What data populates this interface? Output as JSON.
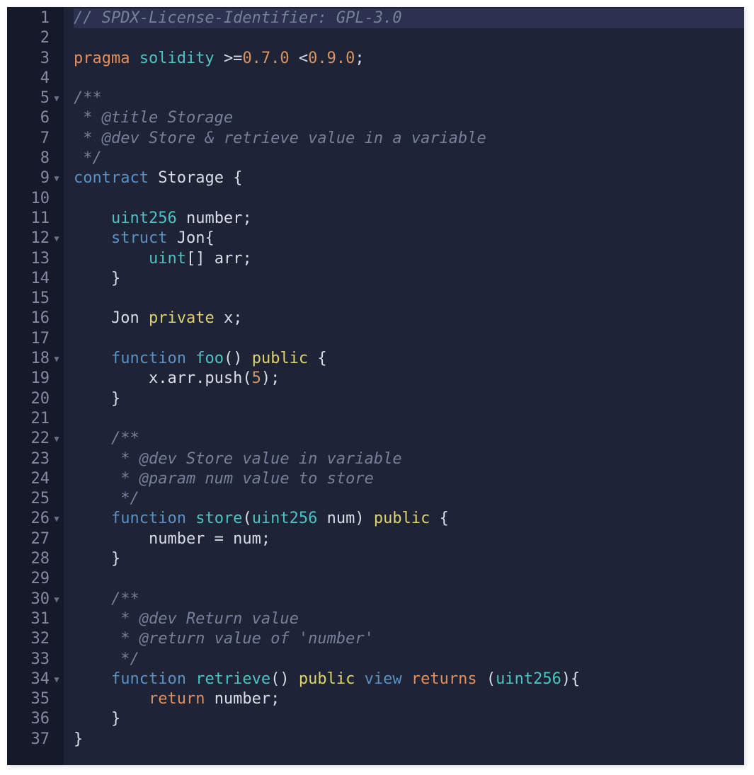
{
  "lines": [
    {
      "n": 1,
      "fold": false,
      "active": true,
      "tokens": [
        {
          "t": "// SPDX-License-Identifier: GPL-3.0",
          "c": "c"
        }
      ]
    },
    {
      "n": 2,
      "fold": false,
      "tokens": [
        {
          "t": "",
          "c": "op"
        }
      ]
    },
    {
      "n": 3,
      "fold": false,
      "tokens": [
        {
          "t": "pragma ",
          "c": "kw"
        },
        {
          "t": "solidity ",
          "c": "cy"
        },
        {
          "t": ">=",
          "c": "op"
        },
        {
          "t": "0.7.0",
          "c": "nm"
        },
        {
          "t": " <",
          "c": "op"
        },
        {
          "t": "0.9.0",
          "c": "nm"
        },
        {
          "t": ";",
          "c": "op"
        }
      ]
    },
    {
      "n": 4,
      "fold": false,
      "tokens": [
        {
          "t": "",
          "c": "op"
        }
      ]
    },
    {
      "n": 5,
      "fold": true,
      "tokens": [
        {
          "t": "/**",
          "c": "c"
        }
      ]
    },
    {
      "n": 6,
      "fold": false,
      "tokens": [
        {
          "t": " * @title Storage",
          "c": "c"
        }
      ]
    },
    {
      "n": 7,
      "fold": false,
      "tokens": [
        {
          "t": " * @dev Store & retrieve value in a variable",
          "c": "c"
        }
      ]
    },
    {
      "n": 8,
      "fold": false,
      "tokens": [
        {
          "t": " */",
          "c": "c"
        }
      ]
    },
    {
      "n": 9,
      "fold": true,
      "tokens": [
        {
          "t": "contract ",
          "c": "kw2"
        },
        {
          "t": "Storage ",
          "c": "op"
        },
        {
          "t": "{",
          "c": "op"
        }
      ]
    },
    {
      "n": 10,
      "fold": false,
      "tokens": [
        {
          "t": "",
          "c": "op"
        }
      ]
    },
    {
      "n": 11,
      "fold": false,
      "tokens": [
        {
          "t": "    ",
          "c": "op"
        },
        {
          "t": "uint256 ",
          "c": "cy"
        },
        {
          "t": "number",
          "c": "op"
        },
        {
          "t": ";",
          "c": "op"
        }
      ]
    },
    {
      "n": 12,
      "fold": true,
      "tokens": [
        {
          "t": "    ",
          "c": "op"
        },
        {
          "t": "struct ",
          "c": "kw2"
        },
        {
          "t": "Jon",
          "c": "op"
        },
        {
          "t": "{",
          "c": "op"
        }
      ]
    },
    {
      "n": 13,
      "fold": false,
      "tokens": [
        {
          "t": "        ",
          "c": "op"
        },
        {
          "t": "uint",
          "c": "cy"
        },
        {
          "t": "[] ",
          "c": "op"
        },
        {
          "t": "arr",
          "c": "op"
        },
        {
          "t": ";",
          "c": "op"
        }
      ]
    },
    {
      "n": 14,
      "fold": false,
      "tokens": [
        {
          "t": "    }",
          "c": "op"
        }
      ]
    },
    {
      "n": 15,
      "fold": false,
      "tokens": [
        {
          "t": "",
          "c": "op"
        }
      ]
    },
    {
      "n": 16,
      "fold": false,
      "tokens": [
        {
          "t": "    Jon ",
          "c": "op"
        },
        {
          "t": "private ",
          "c": "yl"
        },
        {
          "t": "x",
          "c": "op"
        },
        {
          "t": ";",
          "c": "op"
        }
      ]
    },
    {
      "n": 17,
      "fold": false,
      "tokens": [
        {
          "t": "",
          "c": "op"
        }
      ]
    },
    {
      "n": 18,
      "fold": true,
      "tokens": [
        {
          "t": "    ",
          "c": "op"
        },
        {
          "t": "function ",
          "c": "kw2"
        },
        {
          "t": "foo",
          "c": "cy"
        },
        {
          "t": "() ",
          "c": "op"
        },
        {
          "t": "public ",
          "c": "yl"
        },
        {
          "t": "{",
          "c": "op"
        }
      ]
    },
    {
      "n": 19,
      "fold": false,
      "tokens": [
        {
          "t": "        x.arr.push(",
          "c": "op"
        },
        {
          "t": "5",
          "c": "nm"
        },
        {
          "t": ");",
          "c": "op"
        }
      ]
    },
    {
      "n": 20,
      "fold": false,
      "tokens": [
        {
          "t": "    }",
          "c": "op"
        }
      ]
    },
    {
      "n": 21,
      "fold": false,
      "tokens": [
        {
          "t": "",
          "c": "op"
        }
      ]
    },
    {
      "n": 22,
      "fold": true,
      "tokens": [
        {
          "t": "    /**",
          "c": "c"
        }
      ]
    },
    {
      "n": 23,
      "fold": false,
      "tokens": [
        {
          "t": "     * @dev Store value in variable",
          "c": "c"
        }
      ]
    },
    {
      "n": 24,
      "fold": false,
      "tokens": [
        {
          "t": "     * @param num value to store",
          "c": "c"
        }
      ]
    },
    {
      "n": 25,
      "fold": false,
      "tokens": [
        {
          "t": "     */",
          "c": "c"
        }
      ]
    },
    {
      "n": 26,
      "fold": true,
      "tokens": [
        {
          "t": "    ",
          "c": "op"
        },
        {
          "t": "function ",
          "c": "kw2"
        },
        {
          "t": "store",
          "c": "cy"
        },
        {
          "t": "(",
          "c": "op"
        },
        {
          "t": "uint256 ",
          "c": "cy"
        },
        {
          "t": "num",
          "c": "op"
        },
        {
          "t": ") ",
          "c": "op"
        },
        {
          "t": "public ",
          "c": "yl"
        },
        {
          "t": "{",
          "c": "op"
        }
      ]
    },
    {
      "n": 27,
      "fold": false,
      "tokens": [
        {
          "t": "        number = num;",
          "c": "op"
        }
      ]
    },
    {
      "n": 28,
      "fold": false,
      "tokens": [
        {
          "t": "    }",
          "c": "op"
        }
      ]
    },
    {
      "n": 29,
      "fold": false,
      "tokens": [
        {
          "t": "",
          "c": "op"
        }
      ]
    },
    {
      "n": 30,
      "fold": true,
      "tokens": [
        {
          "t": "    /**",
          "c": "c"
        }
      ]
    },
    {
      "n": 31,
      "fold": false,
      "tokens": [
        {
          "t": "     * @dev Return value ",
          "c": "c"
        }
      ]
    },
    {
      "n": 32,
      "fold": false,
      "tokens": [
        {
          "t": "     * @return value of 'number'",
          "c": "c"
        }
      ]
    },
    {
      "n": 33,
      "fold": false,
      "tokens": [
        {
          "t": "     */",
          "c": "c"
        }
      ]
    },
    {
      "n": 34,
      "fold": true,
      "tokens": [
        {
          "t": "    ",
          "c": "op"
        },
        {
          "t": "function ",
          "c": "kw2"
        },
        {
          "t": "retrieve",
          "c": "cy"
        },
        {
          "t": "() ",
          "c": "op"
        },
        {
          "t": "public ",
          "c": "yl"
        },
        {
          "t": "view ",
          "c": "kw2"
        },
        {
          "t": "returns ",
          "c": "kw"
        },
        {
          "t": "(",
          "c": "op"
        },
        {
          "t": "uint256",
          "c": "cy"
        },
        {
          "t": "){",
          "c": "op"
        }
      ]
    },
    {
      "n": 35,
      "fold": false,
      "tokens": [
        {
          "t": "        ",
          "c": "op"
        },
        {
          "t": "return ",
          "c": "kw"
        },
        {
          "t": "number;",
          "c": "op"
        }
      ]
    },
    {
      "n": 36,
      "fold": false,
      "tokens": [
        {
          "t": "    }",
          "c": "op"
        }
      ]
    },
    {
      "n": 37,
      "fold": false,
      "tokens": [
        {
          "t": "}",
          "c": "op"
        }
      ]
    }
  ]
}
